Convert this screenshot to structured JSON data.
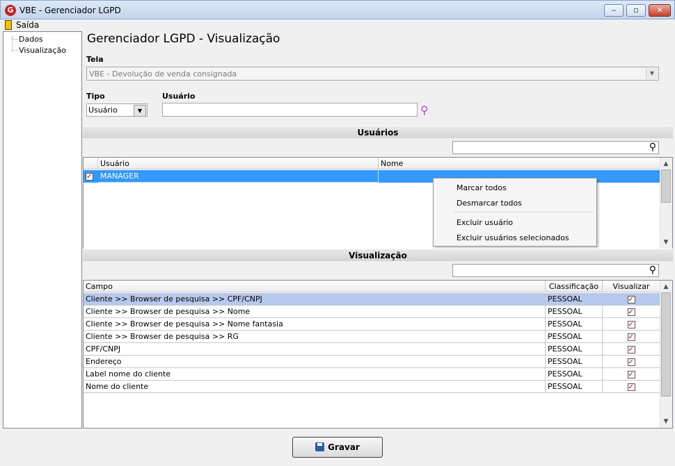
{
  "window": {
    "title": "VBE - Gerenciador LGPD",
    "app_icon": "G",
    "minimize": "‒",
    "maximize": "▫",
    "close": "✕"
  },
  "menu": {
    "exit_label": "Saída"
  },
  "tree": {
    "items": [
      "Dados",
      "Visualização"
    ]
  },
  "page": {
    "title": "Gerenciador LGPD - Visualização"
  },
  "tela": {
    "label": "Tela",
    "value": "VBE - Devolução de venda consignada"
  },
  "tipo": {
    "label": "Tipo",
    "value": "Usuário"
  },
  "usuario": {
    "label": "Usuário",
    "value": ""
  },
  "users_section": {
    "title": "Usuários",
    "columns": [
      "Usuário",
      "Nome"
    ],
    "rows": [
      {
        "usuario": "MANAGER",
        "nome": "",
        "checked": true
      }
    ]
  },
  "context_menu": {
    "items": [
      "Marcar todos",
      "Desmarcar todos",
      "Excluir usuário",
      "Excluir usuários selecionados"
    ]
  },
  "view_section": {
    "title": "Visualização",
    "columns": [
      "Campo",
      "Classificação",
      "Visualizar"
    ],
    "rows": [
      {
        "campo": "Cliente >> Browser de pesquisa >> CPF/CNPJ",
        "classificacao": "PESSOAL",
        "visualizar": true
      },
      {
        "campo": "Cliente >> Browser de pesquisa >> Nome",
        "classificacao": "PESSOAL",
        "visualizar": true
      },
      {
        "campo": "Cliente >> Browser de pesquisa >> Nome fantasia",
        "classificacao": "PESSOAL",
        "visualizar": true
      },
      {
        "campo": "Cliente >> Browser de pesquisa >> RG",
        "classificacao": "PESSOAL",
        "visualizar": true
      },
      {
        "campo": "CPF/CNPJ",
        "classificacao": "PESSOAL",
        "visualizar": true
      },
      {
        "campo": "Endereço",
        "classificacao": "PESSOAL",
        "visualizar": true
      },
      {
        "campo": "Label nome do cliente",
        "classificacao": "PESSOAL",
        "visualizar": true
      },
      {
        "campo": "Nome do cliente",
        "classificacao": "PESSOAL",
        "visualizar": true
      }
    ]
  },
  "save_button": {
    "label": "Gravar"
  },
  "colors": {
    "selection": "#3399ff",
    "selected_row": "#b6c8ec",
    "accent_icon": "#b04fd0"
  }
}
